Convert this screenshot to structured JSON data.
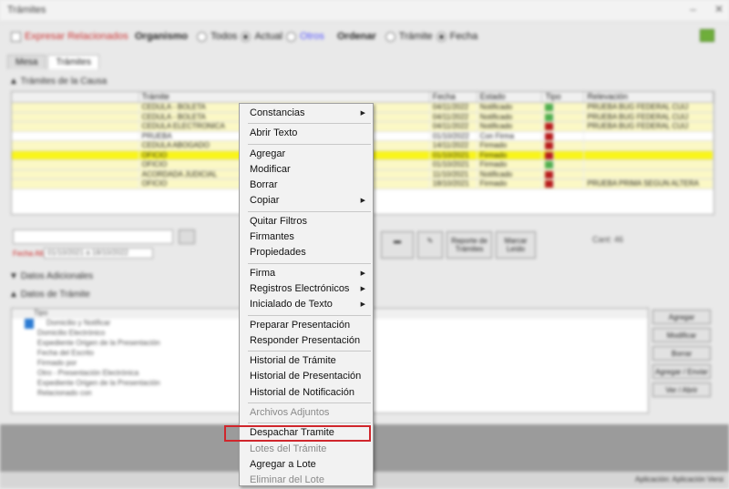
{
  "window": {
    "title": "Trámites"
  },
  "filters": {
    "organismo_label": "Organismo",
    "options_org": [
      "Todos",
      "Actual",
      "Otros"
    ],
    "ordenar_label": "Ordenar",
    "options_ord": [
      "Trámite",
      "Fecha"
    ],
    "left_check": "Expresar Relacionados"
  },
  "tabs": [
    "Mesa",
    "Trámites"
  ],
  "sections": {
    "top": "Trámites de la Causa",
    "middle": "Datos Adicionales",
    "bottom": "Datos de Trámite"
  },
  "grid": {
    "columns": [
      "Trámite",
      "Fecha",
      "Estado",
      "Tipo",
      "Relevación"
    ],
    "rows": [
      {
        "style": "yellow",
        "tramite": "CEDULA - BOLETA",
        "fecha": "04/11/2022",
        "estado": "Notificado",
        "tipo": "green",
        "rel": "PRUEBA BUG FEDERAL CUIJ"
      },
      {
        "style": "yellow",
        "tramite": "CEDULA - BOLETA",
        "fecha": "04/11/2022",
        "estado": "Notificado",
        "tipo": "green",
        "rel": "PRUEBA BUG FEDERAL CUIJ"
      },
      {
        "style": "yellow",
        "tramite": "CEDULA ELECTRONICA",
        "fecha": "04/11/2022",
        "estado": "Notificado",
        "tipo": "red",
        "rel": "PRUEBA BUG FEDERAL CUIJ"
      },
      {
        "style": "white",
        "tramite": "PRUEBA",
        "fecha": "01/10/2022",
        "estado": "Con Firma",
        "tipo": "red",
        "rel": ""
      },
      {
        "style": "yellow",
        "tramite": "CEDULA ABOGADO",
        "fecha": "14/11/2022",
        "estado": "Firmado",
        "tipo": "red",
        "rel": ""
      },
      {
        "style": "highlight",
        "tramite": "OFICIO",
        "fecha": "01/10/2021",
        "estado": "Firmado",
        "tipo": "red",
        "rel": ""
      },
      {
        "style": "yellow",
        "tramite": "OFICIO",
        "fecha": "01/10/2021",
        "estado": "Firmado",
        "tipo": "green",
        "rel": ""
      },
      {
        "style": "yellow",
        "tramite": "ACORDADA JUDICIAL",
        "fecha": "11/10/2021",
        "estado": "Notificado",
        "tipo": "red",
        "rel": ""
      },
      {
        "style": "yellow",
        "tramite": "OFICIO",
        "fecha": "18/10/2021",
        "estado": "Firmado",
        "tipo": "red",
        "rel": "PRUEBA PRIMA SEGUN ALTERA"
      }
    ]
  },
  "search": {
    "fecha_label": "Fecha Alta",
    "fecha_value": "01/10/2021 a 18/10/2022"
  },
  "toolbar": {
    "btn1": "",
    "btn2": "",
    "btn3": "Reporte de Trámites",
    "btn4": "Marcar Leído",
    "cant": "Cant: 46"
  },
  "bottom_list": {
    "header": "Tipo",
    "items": [
      "Domicilio y Notificar",
      "Domicilio Electrónico",
      "Expediente Origen de la Presentación",
      "Fecha del Escrito",
      "Firmado por",
      "Otro - Presentación Electrónica",
      "Expediente Origen de la Presentación",
      "Relacionado con"
    ]
  },
  "right_buttons": [
    "Agregar",
    "Modificar",
    "Borrar",
    "Agregar / Enviar",
    "Ver / Abrir"
  ],
  "footer": {
    "text": "Aplicación: Aplicación Versi"
  },
  "context_menu": {
    "groups": [
      [
        {
          "label": "Constancias",
          "submenu": true,
          "disabled": false
        }
      ],
      [
        {
          "label": "Abrir Texto",
          "submenu": false,
          "disabled": false
        }
      ],
      [
        {
          "label": "Agregar",
          "submenu": false,
          "disabled": false
        },
        {
          "label": "Modificar",
          "submenu": false,
          "disabled": false
        },
        {
          "label": "Borrar",
          "submenu": false,
          "disabled": false
        },
        {
          "label": "Copiar",
          "submenu": true,
          "disabled": false
        }
      ],
      [
        {
          "label": "Quitar Filtros",
          "submenu": false,
          "disabled": false
        },
        {
          "label": "Firmantes",
          "submenu": false,
          "disabled": false
        },
        {
          "label": "Propiedades",
          "submenu": false,
          "disabled": false
        }
      ],
      [
        {
          "label": "Firma",
          "submenu": true,
          "disabled": false
        },
        {
          "label": "Registros Electrónicos",
          "submenu": true,
          "disabled": false
        },
        {
          "label": "Inicialado de Texto",
          "submenu": true,
          "disabled": false
        }
      ],
      [
        {
          "label": "Preparar Presentación",
          "submenu": false,
          "disabled": false
        },
        {
          "label": "Responder Presentación",
          "submenu": false,
          "disabled": false
        }
      ],
      [
        {
          "label": "Historial de Trámite",
          "submenu": false,
          "disabled": false
        },
        {
          "label": "Historial de Presentación",
          "submenu": false,
          "disabled": false
        },
        {
          "label": "Historial de Notificación",
          "submenu": false,
          "disabled": false
        }
      ],
      [
        {
          "label": "Archivos Adjuntos",
          "submenu": false,
          "disabled": true
        }
      ],
      [
        {
          "label": "Despachar Tramite",
          "submenu": false,
          "disabled": false,
          "highlighted": true
        },
        {
          "label": "Lotes del Trámite",
          "submenu": false,
          "disabled": true
        },
        {
          "label": "Agregar a Lote",
          "submenu": false,
          "disabled": false
        },
        {
          "label": "Eliminar del Lote",
          "submenu": false,
          "disabled": true
        }
      ]
    ],
    "highlight_color": "#d0262c"
  }
}
